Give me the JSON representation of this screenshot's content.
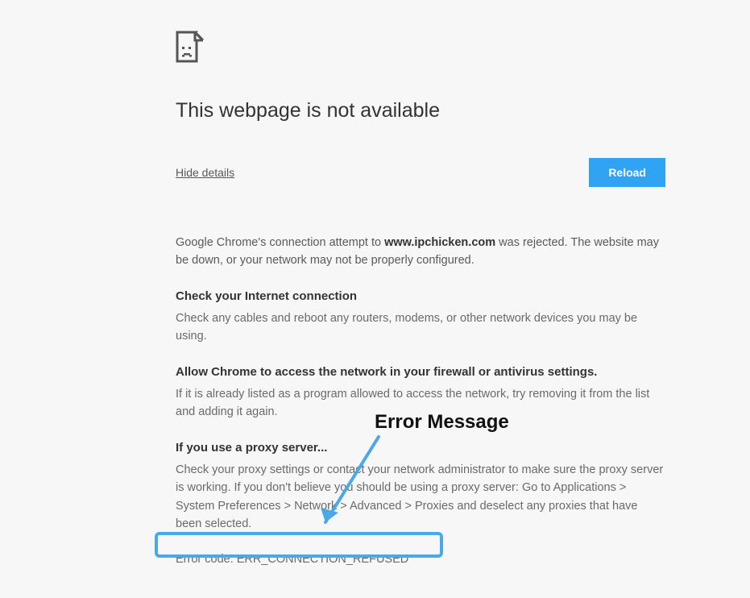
{
  "title": "This webpage is not available",
  "details_link": "Hide details",
  "reload_label": "Reload",
  "description_prefix": "Google Chrome's connection attempt to ",
  "description_domain": "www.ipchicken.com",
  "description_suffix": " was rejected. The website may be down, or your network may not be properly configured.",
  "sections": [
    {
      "heading": "Check your Internet connection",
      "body": "Check any cables and reboot any routers, modems, or other network devices you may be using."
    },
    {
      "heading": "Allow Chrome to access the network in your firewall or antivirus settings.",
      "body": "If it is already listed as a program allowed to access the network, try removing it from the list and adding it again."
    },
    {
      "heading": "If you use a proxy server...",
      "body": "Check your proxy settings or contact your network administrator to make sure the proxy server is working. If you don't believe you should be using a proxy server: Go to Applications > System Preferences > Network > Advanced > Proxies and deselect any proxies that have been selected."
    }
  ],
  "error_code": "Error code: ERR_CONNECTION_REFUSED",
  "annotation_label": "Error Message"
}
